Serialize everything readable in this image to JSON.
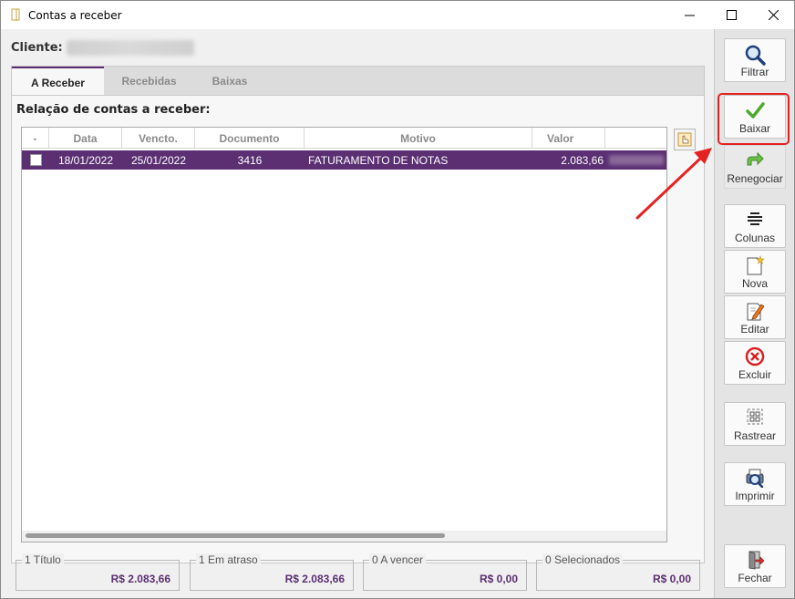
{
  "window": {
    "title": "Contas a receber"
  },
  "client": {
    "label": "Cliente:",
    "value": ""
  },
  "tabs": [
    {
      "label": "A Receber",
      "active": true
    },
    {
      "label": "Recebidas",
      "active": false
    },
    {
      "label": "Baixas",
      "active": false
    }
  ],
  "section_title": "Relação de contas a receber:",
  "table": {
    "headers": [
      "-",
      "Data",
      "Vencto.",
      "Documento",
      "Motivo",
      "Valor",
      ""
    ],
    "rows": [
      {
        "checked": false,
        "data": "18/01/2022",
        "vencto": "25/01/2022",
        "documento": "3416",
        "motivo": "FATURAMENTO DE NOTAS",
        "valor": "2.083,66",
        "extra": ""
      }
    ]
  },
  "summary": [
    {
      "label": "1 Título",
      "value": "R$ 2.083,66"
    },
    {
      "label": "1 Em atraso",
      "value": "R$ 2.083,66"
    },
    {
      "label": "0 A vencer",
      "value": "R$ 0,00"
    },
    {
      "label": "0 Selecionados",
      "value": "R$ 0,00"
    }
  ],
  "toolbar": {
    "filtrar": "Filtrar",
    "baixar": "Baixar",
    "renegociar": "Renegociar",
    "colunas": "Colunas",
    "nova": "Nova",
    "editar": "Editar",
    "excluir": "Excluir",
    "rastrear": "Rastrear",
    "imprimir": "Imprimir",
    "fechar": "Fechar"
  },
  "colors": {
    "accent": "#5b2f72",
    "highlight": "#e52222"
  }
}
